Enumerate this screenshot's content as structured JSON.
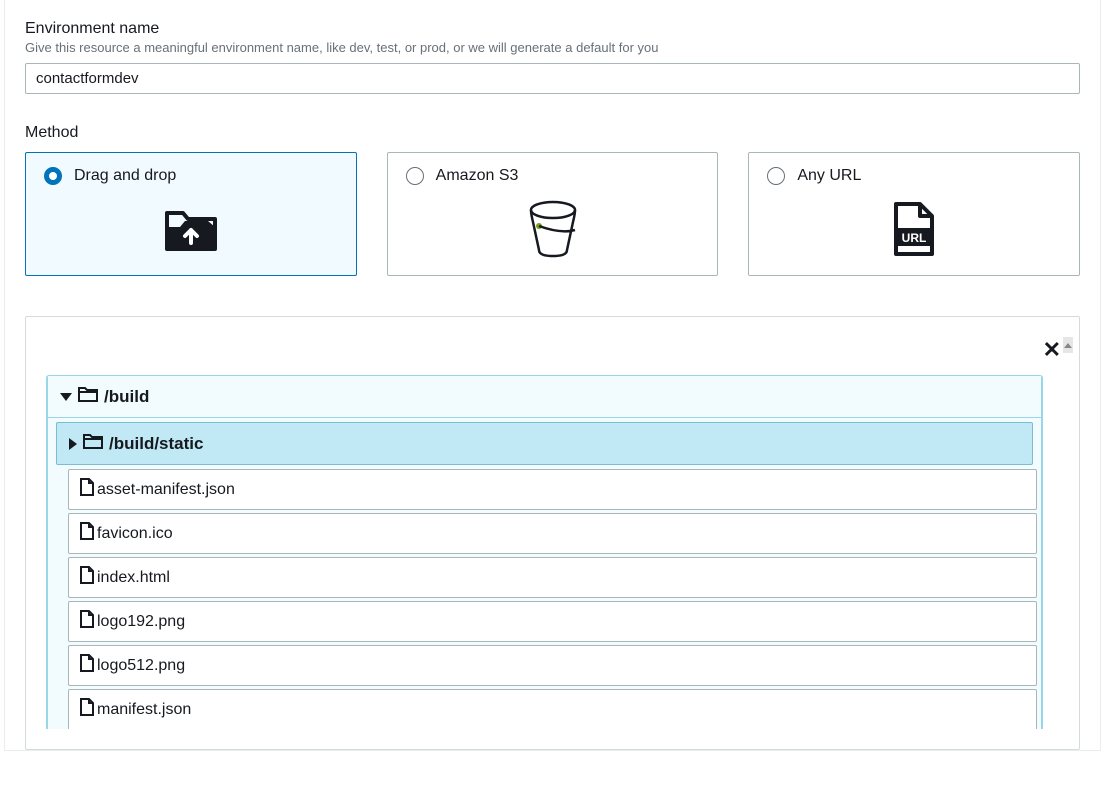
{
  "env": {
    "label": "Environment name",
    "help": "Give this resource a meaningful environment name, like dev, test, or prod, or we will generate a default for you",
    "value": "contactformdev"
  },
  "method": {
    "label": "Method",
    "selected": 0,
    "options": [
      {
        "label": "Drag and drop",
        "icon": "upload-folder"
      },
      {
        "label": "Amazon S3",
        "icon": "bucket"
      },
      {
        "label": "Any URL",
        "icon": "url-file"
      }
    ]
  },
  "tree": {
    "root": {
      "path": "/build",
      "expanded": true,
      "children": [
        {
          "type": "folder",
          "path": "/build/static",
          "expanded": false
        },
        {
          "type": "file",
          "name": "asset-manifest.json"
        },
        {
          "type": "file",
          "name": "favicon.ico"
        },
        {
          "type": "file",
          "name": "index.html"
        },
        {
          "type": "file",
          "name": "logo192.png"
        },
        {
          "type": "file",
          "name": "logo512.png"
        },
        {
          "type": "file",
          "name": "manifest.json"
        }
      ]
    }
  }
}
